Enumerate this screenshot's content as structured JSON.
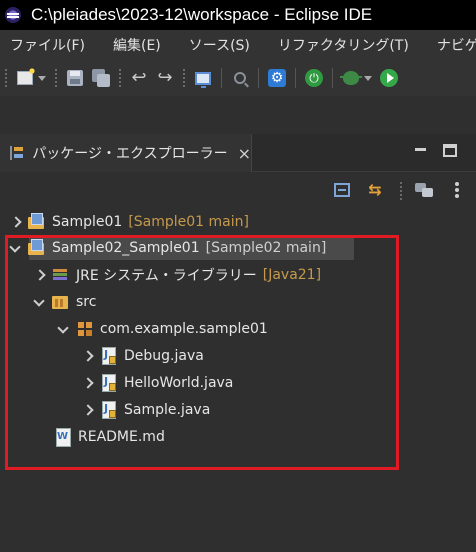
{
  "window": {
    "title": "C:\\pleiades\\2023-12\\workspace - Eclipse IDE",
    "app_icon": "eclipse-icon"
  },
  "menubar": {
    "items": [
      "ファイル(F)",
      "編集(E)",
      "ソース(S)",
      "リファクタリング(T)",
      "ナビゲ"
    ]
  },
  "toolbar": {
    "icons": [
      "new-wizard-icon",
      "save-icon",
      "save-all-icon",
      "undo-icon",
      "redo-icon",
      "open-console-icon",
      "search-icon",
      "settings-icon",
      "server-start-icon",
      "debug-icon",
      "run-icon"
    ]
  },
  "view": {
    "tab_label": "パッケージ・エクスプローラー",
    "close_glyph": "×"
  },
  "tree": {
    "rows": [
      {
        "name": "Sample01",
        "deco": "[Sample01 main]"
      },
      {
        "name": "Sample02_Sample01",
        "deco": "[Sample02 main]"
      },
      {
        "name": "JRE システム・ライブラリー",
        "deco": "[Java21]"
      },
      {
        "name": "src",
        "deco": ""
      },
      {
        "name": "com.example.sample01",
        "deco": ""
      },
      {
        "name": "Debug.java",
        "deco": ""
      },
      {
        "name": "HelloWorld.java",
        "deco": ""
      },
      {
        "name": "Sample.java",
        "deco": ""
      },
      {
        "name": "README.md",
        "deco": ""
      }
    ]
  },
  "colors": {
    "annotation_border": "#e01b24",
    "decoration_text": "#c59a4c",
    "background": "#2f2f2f"
  }
}
